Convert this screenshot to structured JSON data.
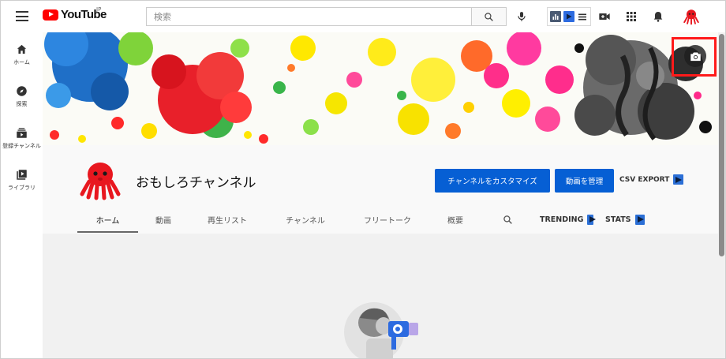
{
  "header": {
    "logo_text": "YouTube",
    "logo_country": "JP",
    "search_placeholder": "検索"
  },
  "sidebar": {
    "items": [
      {
        "label": "ホーム",
        "icon": "home-icon"
      },
      {
        "label": "探索",
        "icon": "explore-icon"
      },
      {
        "label": "登録チャンネル",
        "icon": "subscriptions-icon"
      },
      {
        "label": "ライブラリ",
        "icon": "library-icon"
      }
    ]
  },
  "channel": {
    "name": "おもしろチャンネル",
    "customize_label": "チャンネルをカスタマイズ",
    "manage_label": "動画を管理",
    "csv_export_label": "CSV EXPORT"
  },
  "tabs": [
    {
      "label": "ホーム",
      "active": true
    },
    {
      "label": "動画"
    },
    {
      "label": "再生リスト"
    },
    {
      "label": "チャンネル"
    },
    {
      "label": "フリートーク"
    },
    {
      "label": "概要"
    }
  ],
  "extra_tabs": {
    "trending": "TRENDING",
    "stats": "STATS"
  },
  "colors": {
    "accent_blue": "#065fd4",
    "brand_red": "#ff0000",
    "highlight_red": "#ff1a1a",
    "avatar_red": "#e8171f"
  }
}
